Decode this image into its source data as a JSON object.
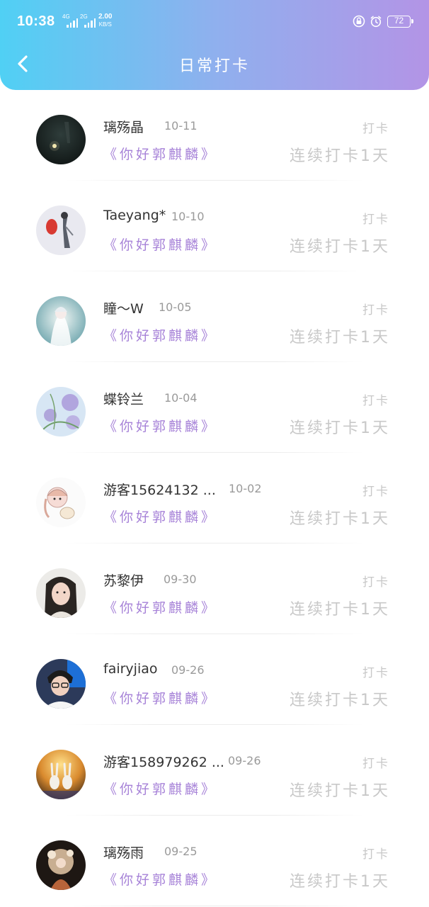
{
  "status_bar": {
    "time": "10:38",
    "net1": "4G",
    "net2": "2G",
    "speed_value": "2.00",
    "speed_unit": "KB/S",
    "battery": "72",
    "icons": [
      "lock-icon",
      "alarm-clock-icon"
    ]
  },
  "header": {
    "title": "日常打卡",
    "back_icon": "chevron-left-icon"
  },
  "entries": [
    {
      "name": "璃殇晶",
      "date": "10-11",
      "topic": "《你好郭麒麟》",
      "action": "打卡",
      "streak": "连续打卡1天"
    },
    {
      "name": "Taeyang*",
      "date": "10-10",
      "topic": "《你好郭麒麟》",
      "action": "打卡",
      "streak": "连续打卡1天"
    },
    {
      "name": "瞳～W",
      "date": "10-05",
      "topic": "《你好郭麒麟》",
      "action": "打卡",
      "streak": "连续打卡1天"
    },
    {
      "name": "蝶铃兰",
      "date": "10-04",
      "topic": "《你好郭麒麟》",
      "action": "打卡",
      "streak": "连续打卡1天"
    },
    {
      "name": "游客15624132 ...",
      "date": "10-02",
      "topic": "《你好郭麒麟》",
      "action": "打卡",
      "streak": "连续打卡1天"
    },
    {
      "name": "苏黎伊",
      "date": "09-30",
      "topic": "《你好郭麒麟》",
      "action": "打卡",
      "streak": "连续打卡1天"
    },
    {
      "name": "fairyjiao",
      "date": "09-26",
      "topic": "《你好郭麒麟》",
      "action": "打卡",
      "streak": "连续打卡1天"
    },
    {
      "name": "游客158979262 ...",
      "date": "09-26",
      "topic": "《你好郭麒麟》",
      "action": "打卡",
      "streak": "连续打卡1天"
    },
    {
      "name": "璃殇雨",
      "date": "09-25",
      "topic": "《你好郭麒麟》",
      "action": "打卡",
      "streak": "连续打卡1天"
    }
  ],
  "colors": {
    "header_gradient_start": "#50d0f4",
    "header_gradient_end": "#b394e6",
    "topic": "#a783d8",
    "muted": "#c8c8c8"
  }
}
